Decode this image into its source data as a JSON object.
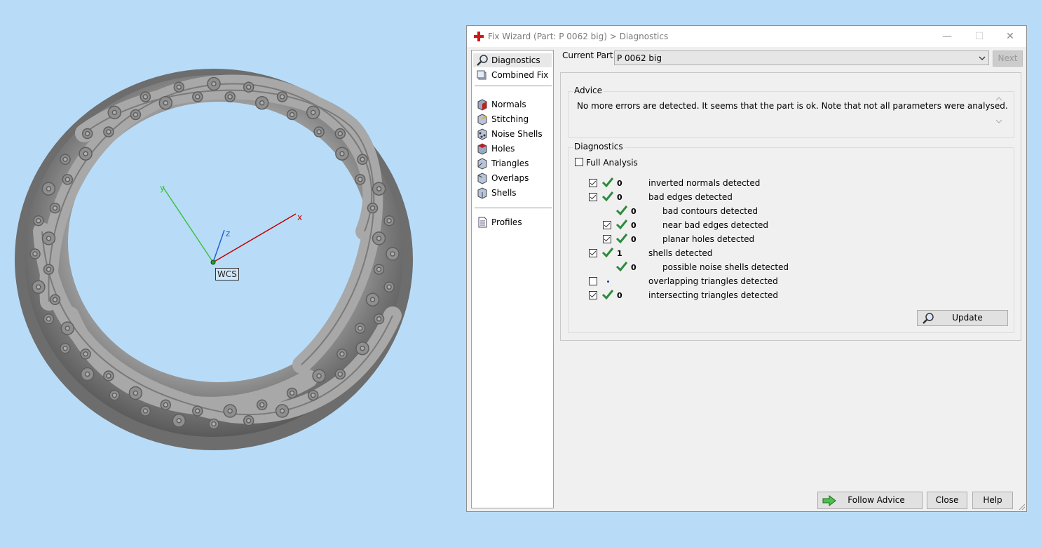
{
  "viewport": {
    "axis_x": "x",
    "axis_y": "y",
    "axis_z": "z",
    "wcs_label": "WCS"
  },
  "window": {
    "title": "Fix Wizard (Part: P 0062 big) > Diagnostics",
    "minimize": "—",
    "maximize": "☐",
    "close": "✕"
  },
  "nav": {
    "items": [
      {
        "label": "Diagnostics",
        "icon": "magnifier-icon"
      },
      {
        "label": "Combined Fix",
        "icon": "combined-fix-icon"
      },
      {
        "label": "Normals",
        "icon": "normals-cube-icon"
      },
      {
        "label": "Stitching",
        "icon": "stitching-cube-icon"
      },
      {
        "label": "Noise Shells",
        "icon": "noise-shells-cube-icon"
      },
      {
        "label": "Holes",
        "icon": "holes-cube-icon"
      },
      {
        "label": "Triangles",
        "icon": "triangles-cube-icon"
      },
      {
        "label": "Overlaps",
        "icon": "overlaps-cube-icon"
      },
      {
        "label": "Shells",
        "icon": "shells-cube-icon"
      },
      {
        "label": "Profiles",
        "icon": "document-icon"
      }
    ]
  },
  "current_part": {
    "label": "Current Part:",
    "value": "P 0062 big"
  },
  "next_button": "Next",
  "advice": {
    "title": "Advice",
    "text": "No more errors are detected. It seems that the part is ok. Note that not all parameters were analysed."
  },
  "diagnostics": {
    "title": "Diagnostics",
    "full_analysis": "Full Analysis",
    "rows": [
      {
        "checked": true,
        "status": "ok",
        "value": "0",
        "label": "inverted normals detected",
        "indent": 0
      },
      {
        "checked": true,
        "status": "ok",
        "value": "0",
        "label": "bad edges detected",
        "indent": 0
      },
      {
        "checked": null,
        "status": "ok",
        "value": "0",
        "label": "bad contours detected",
        "indent": 1
      },
      {
        "checked": true,
        "status": "ok",
        "value": "0",
        "label": "near bad edges detected",
        "indent": 1
      },
      {
        "checked": true,
        "status": "ok",
        "value": "0",
        "label": "planar holes detected",
        "indent": 1
      },
      {
        "checked": true,
        "status": "ok",
        "value": "1",
        "label": "shells detected",
        "indent": 0
      },
      {
        "checked": null,
        "status": "ok",
        "value": "0",
        "label": "possible noise shells detected",
        "indent": 1
      },
      {
        "checked": false,
        "status": "dot",
        "value": "",
        "label": "overlapping triangles detected",
        "indent": 0
      },
      {
        "checked": true,
        "status": "ok",
        "value": "0",
        "label": "intersecting triangles detected",
        "indent": 0
      }
    ],
    "update_button": "Update"
  },
  "footer": {
    "follow_advice": "Follow Advice",
    "close": "Close",
    "help": "Help"
  },
  "colors": {
    "background": "#b8dcf8",
    "tick_green": "#2e8b3e",
    "axis_x": "#c00000",
    "axis_y": "#40c040",
    "axis_z": "#2060d0"
  }
}
